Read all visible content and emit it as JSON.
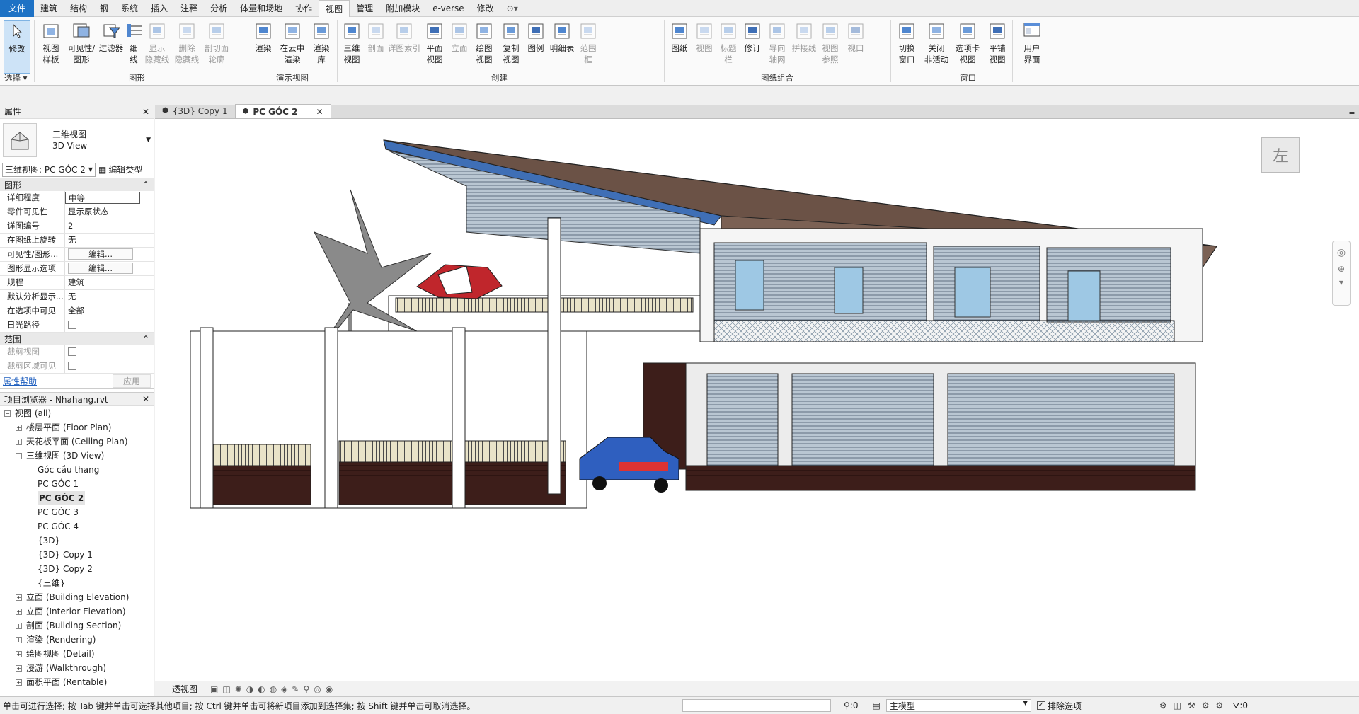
{
  "menu": {
    "tabs": [
      "文件",
      "建筑",
      "结构",
      "钢",
      "系统",
      "插入",
      "注释",
      "分析",
      "体量和场地",
      "协作",
      "视图",
      "管理",
      "附加模块",
      "e-verse",
      "修改"
    ],
    "active_tab": "视图"
  },
  "ribbon": {
    "select": {
      "label": "修改",
      "panel": "选择"
    },
    "graphics": {
      "buttons": [
        "视图\n样板",
        "可见性/\n图形",
        "过滤器",
        "细\n线",
        "显示\n隐藏线",
        "删除\n隐藏线",
        "剖切面\n轮廓"
      ],
      "panel": "图形"
    },
    "presentation": {
      "buttons": [
        "渲染",
        "在云中\n渲染",
        "渲染\n库"
      ],
      "panel": "演示视图"
    },
    "create": {
      "buttons": [
        "三维\n视图",
        "剖面",
        "详图索引",
        "平面\n视图",
        "立面",
        "绘图\n视图",
        "复制\n视图",
        "图例",
        "明细表",
        "范围\n框"
      ],
      "panel": "创建"
    },
    "sheet": {
      "buttons": [
        "图纸",
        "视图",
        "标题\n栏",
        "修订",
        "导向\n轴网",
        "拼接线",
        "视图\n参照",
        "视口"
      ],
      "panel": "图纸组合"
    },
    "window": {
      "buttons": [
        "切换\n窗口",
        "关闭\n非活动",
        "选项卡\n视图",
        "平铺\n视图"
      ],
      "panel": "窗口"
    },
    "ui": {
      "label": "用户\n界面"
    }
  },
  "properties": {
    "title": "属性",
    "type_name": "三维视图",
    "type_sub": "3D View",
    "view_selector": "三维视图: PC GÓC 2",
    "edit_type": "编辑类型",
    "section_graphics": "图形",
    "rows": [
      {
        "name": "详细程度",
        "value": "中等"
      },
      {
        "name": "零件可见性",
        "value": "显示原状态"
      },
      {
        "name": "详图编号",
        "value": "2"
      },
      {
        "name": "在图纸上旋转",
        "value": "无"
      },
      {
        "name": "可见性/图形...",
        "value": "编辑..."
      },
      {
        "name": "图形显示选项",
        "value": "编辑..."
      },
      {
        "name": "规程",
        "value": "建筑"
      },
      {
        "name": "默认分析显示...",
        "value": "无"
      },
      {
        "name": "在选项中可见",
        "value": "全部"
      },
      {
        "name": "日光路径",
        "value": ""
      }
    ],
    "section_extents": "范围",
    "extent_rows": [
      {
        "name": "裁剪视图",
        "value": ""
      },
      {
        "name": "裁剪区域可见",
        "value": ""
      }
    ],
    "help": "属性帮助",
    "apply": "应用"
  },
  "browser": {
    "title": "项目浏览器 - Nhahang.rvt",
    "items": [
      {
        "label": "视图 (all)",
        "level": 0,
        "toggle": "−"
      },
      {
        "label": "楼层平面 (Floor Plan)",
        "level": 1,
        "toggle": "+"
      },
      {
        "label": "天花板平面 (Ceiling Plan)",
        "level": 1,
        "toggle": "+"
      },
      {
        "label": "三维视图 (3D View)",
        "level": 1,
        "toggle": "−"
      },
      {
        "label": "Góc cầu thang",
        "level": 2,
        "toggle": ""
      },
      {
        "label": "PC GÓC 1",
        "level": 2,
        "toggle": ""
      },
      {
        "label": "PC GÓC 2",
        "level": 2,
        "toggle": "",
        "selected": true
      },
      {
        "label": "PC GÓC 3",
        "level": 2,
        "toggle": ""
      },
      {
        "label": "PC GÓC 4",
        "level": 2,
        "toggle": ""
      },
      {
        "label": "{3D}",
        "level": 2,
        "toggle": ""
      },
      {
        "label": "{3D} Copy 1",
        "level": 2,
        "toggle": ""
      },
      {
        "label": "{3D} Copy 2",
        "level": 2,
        "toggle": ""
      },
      {
        "label": "{三维}",
        "level": 2,
        "toggle": ""
      },
      {
        "label": "立面 (Building Elevation)",
        "level": 1,
        "toggle": "+"
      },
      {
        "label": "立面 (Interior Elevation)",
        "level": 1,
        "toggle": "+"
      },
      {
        "label": "剖面 (Building Section)",
        "level": 1,
        "toggle": "+"
      },
      {
        "label": "渲染 (Rendering)",
        "level": 1,
        "toggle": "+"
      },
      {
        "label": "绘图视图 (Detail)",
        "level": 1,
        "toggle": "+"
      },
      {
        "label": "漫游 (Walkthrough)",
        "level": 1,
        "toggle": "+"
      },
      {
        "label": "面积平面 (Rentable)",
        "level": 1,
        "toggle": "+"
      }
    ]
  },
  "view_tabs": [
    {
      "label": "{3D} Copy 1",
      "active": false
    },
    {
      "label": "PC GÓC 2",
      "active": true
    }
  ],
  "viewcube": {
    "face": "左"
  },
  "viewbar": {
    "label": "透视图"
  },
  "status": {
    "message": "单击可进行选择; 按 Tab 键并单击可选择其他项目; 按 Ctrl 键并单击可将新项目添加到选择集; 按 Shift 键并单击可取消选择。",
    "workset_count": ":0",
    "model": "主模型",
    "exclude_options": "排除选项",
    "filter_count": ":0"
  },
  "colors": {
    "file_tab": "#1e72c5",
    "roof": "#6b5246",
    "brick": "#3d1e1a",
    "car": "#2f5fbf",
    "umbrella": "#c0262c",
    "glass": "#9ec8e4"
  }
}
